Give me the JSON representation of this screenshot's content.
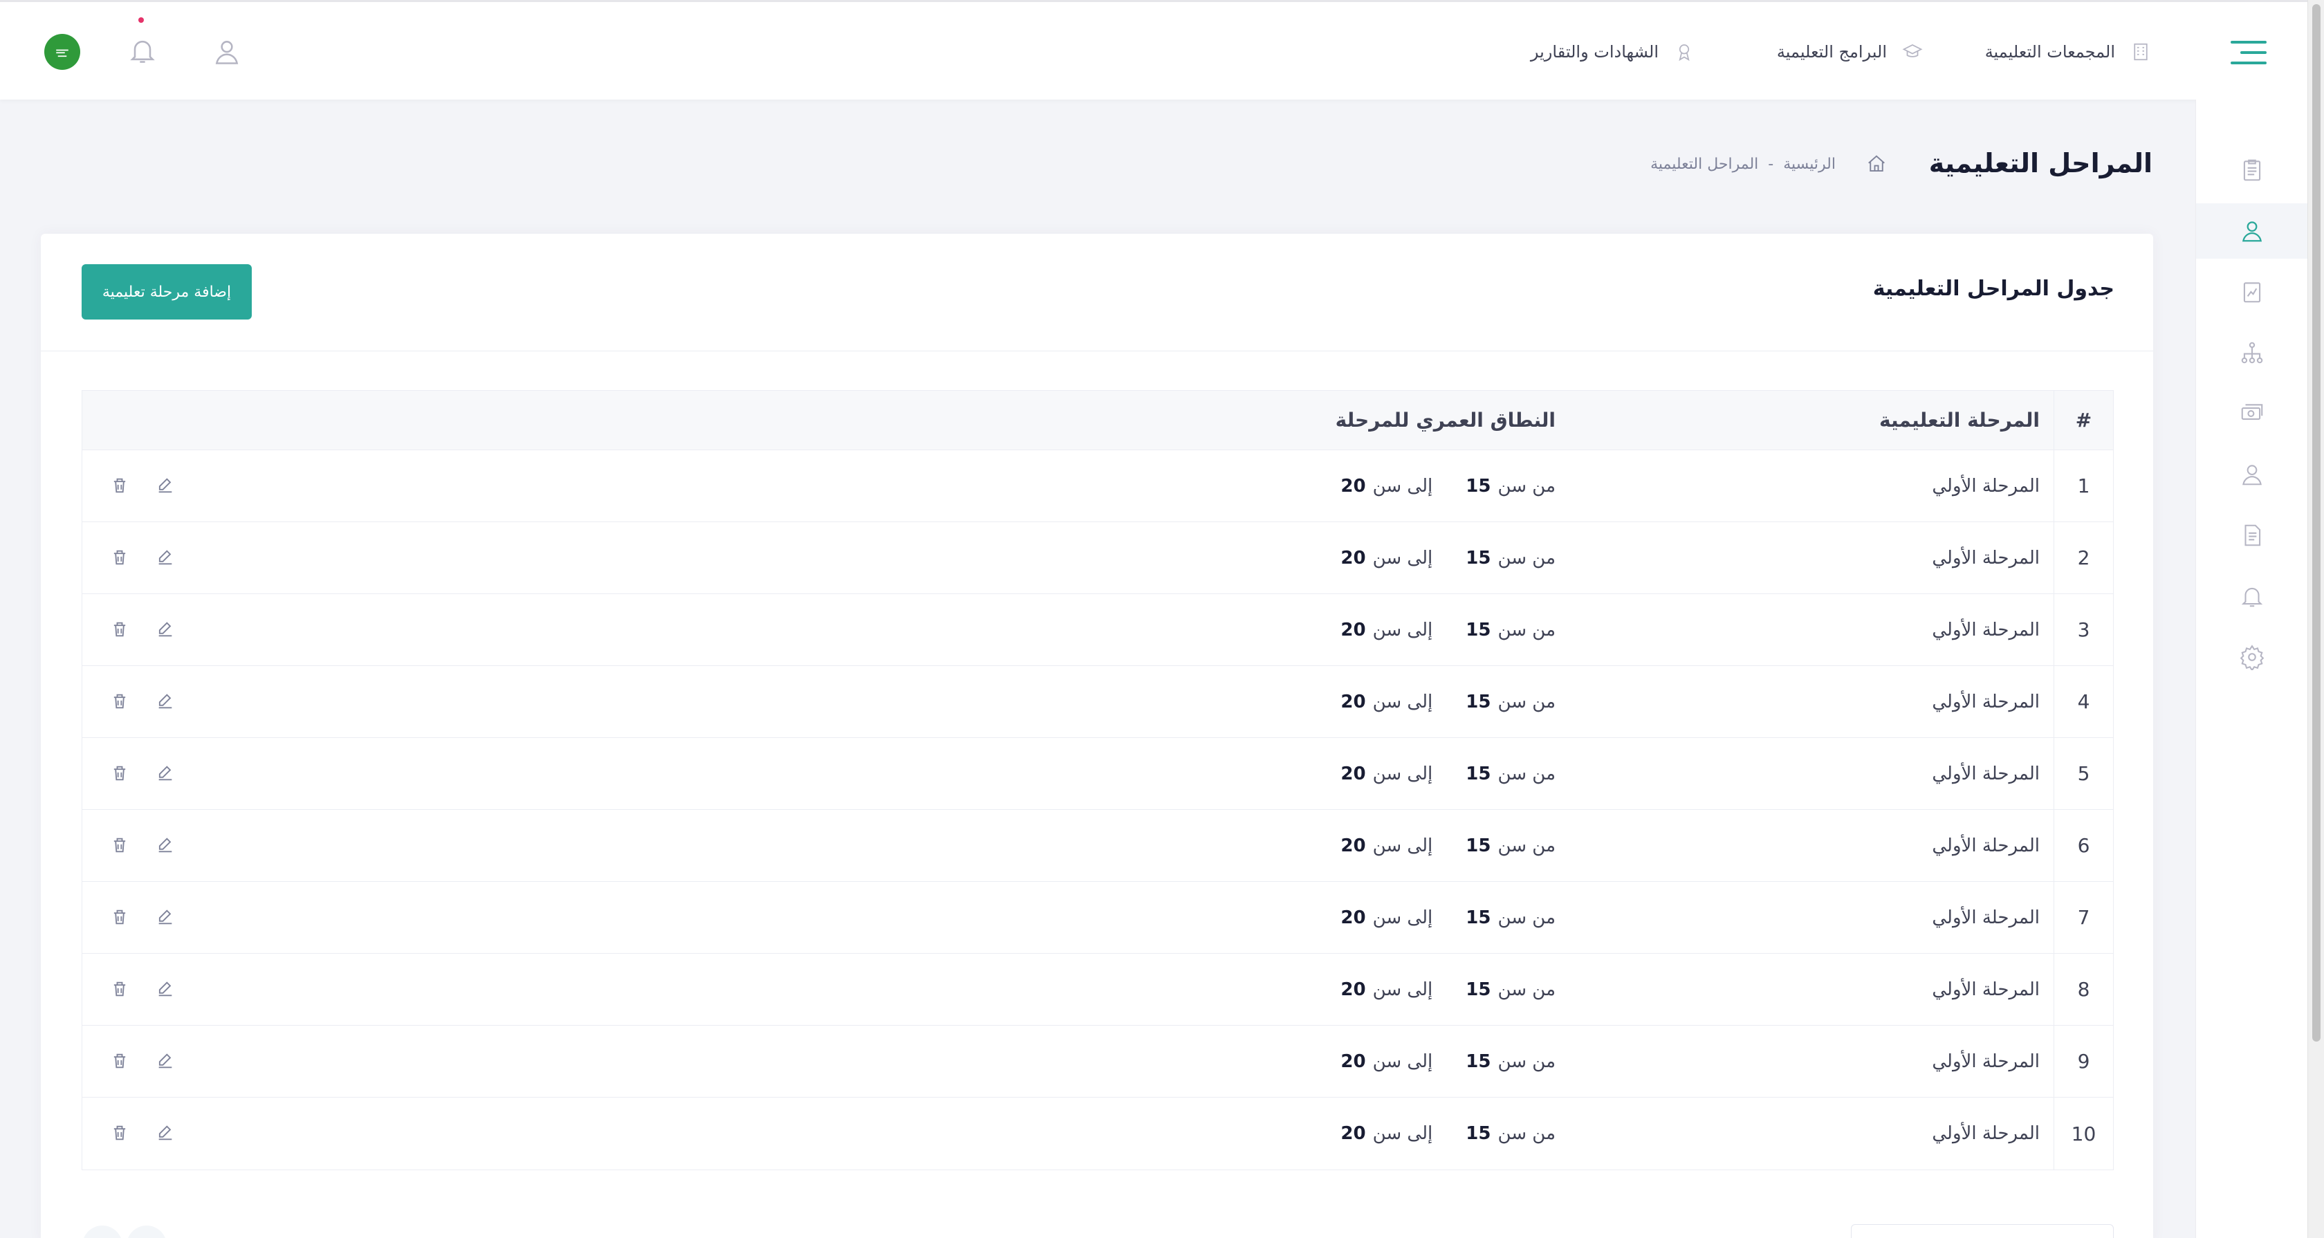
{
  "header": {
    "nav": [
      {
        "label": "المجمعات التعليمية",
        "icon": "building-icon"
      },
      {
        "label": "البرامج التعليمية",
        "icon": "graduation-cap-icon"
      },
      {
        "label": "الشهادات والتقارير",
        "icon": "award-icon"
      }
    ],
    "flag_icon": "flag-icon"
  },
  "page": {
    "title": "المراحل التعليمية",
    "breadcrumb": {
      "home": "الرئيسية",
      "separator": "-",
      "current": "المراحل التعليمية"
    }
  },
  "card": {
    "title": "جدول المراحل التعليمية",
    "add_button": "إضافة مرحلة تعليمية"
  },
  "table": {
    "columns": {
      "num": "#",
      "stage": "المرحلة التعليمية",
      "age": "النطاق العمري للمرحلة"
    },
    "age_from_label": "من سن",
    "age_to_label": "إلى سن",
    "rows": [
      {
        "num": "1",
        "stage": "المرحلة الأولي",
        "from": "15",
        "to": "20"
      },
      {
        "num": "2",
        "stage": "المرحلة الأولي",
        "from": "15",
        "to": "20"
      },
      {
        "num": "3",
        "stage": "المرحلة الأولي",
        "from": "15",
        "to": "20"
      },
      {
        "num": "4",
        "stage": "المرحلة الأولي",
        "from": "15",
        "to": "20"
      },
      {
        "num": "5",
        "stage": "المرحلة الأولي",
        "from": "15",
        "to": "20"
      },
      {
        "num": "6",
        "stage": "المرحلة الأولي",
        "from": "15",
        "to": "20"
      },
      {
        "num": "7",
        "stage": "المرحلة الأولي",
        "from": "15",
        "to": "20"
      },
      {
        "num": "8",
        "stage": "المرحلة الأولي",
        "from": "15",
        "to": "20"
      },
      {
        "num": "9",
        "stage": "المرحلة الأولي",
        "from": "15",
        "to": "20"
      },
      {
        "num": "10",
        "stage": "المرحلة الأولي",
        "from": "15",
        "to": "20"
      }
    ]
  },
  "colors": {
    "accent": "#2aa89a",
    "badge": "#e5336a"
  }
}
